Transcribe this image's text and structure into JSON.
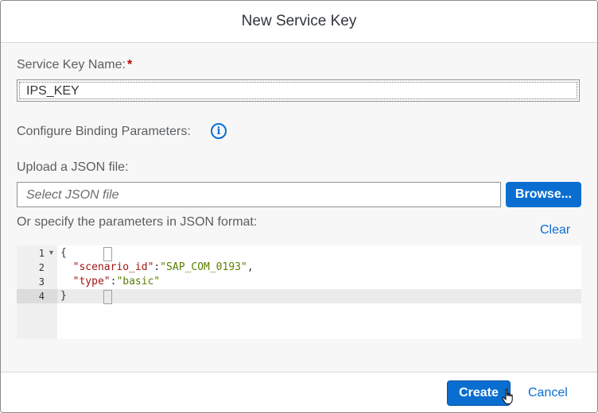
{
  "dialog": {
    "title": "New Service Key"
  },
  "form": {
    "service_key_name_label": "Service Key Name:",
    "required_marker": "*",
    "service_key_name_value": "IPS_KEY",
    "binding_params_label": "Configure Binding Parameters:",
    "info_icon": "info-icon",
    "upload_label": "Upload a JSON file:",
    "file_placeholder": "Select JSON file",
    "browse_label": "Browse...",
    "json_format_label": "Or specify the parameters in JSON format:",
    "clear_label": "Clear"
  },
  "editor": {
    "lines": [
      {
        "num": "1",
        "text": "{"
      },
      {
        "num": "2",
        "key": "\"scenario_id\"",
        "sep": ":",
        "value": "\"SAP_COM_0193\"",
        "tail": ","
      },
      {
        "num": "3",
        "key": "\"type\"",
        "sep": ":",
        "value": "\"basic\"",
        "tail": ""
      },
      {
        "num": "4",
        "text": "}"
      }
    ]
  },
  "footer": {
    "create_label": "Create",
    "cancel_label": "Cancel"
  },
  "colors": {
    "accent": "#0a6ed1",
    "required": "#bb0000",
    "json_key": "#a31515",
    "json_string": "#5a7f00"
  }
}
